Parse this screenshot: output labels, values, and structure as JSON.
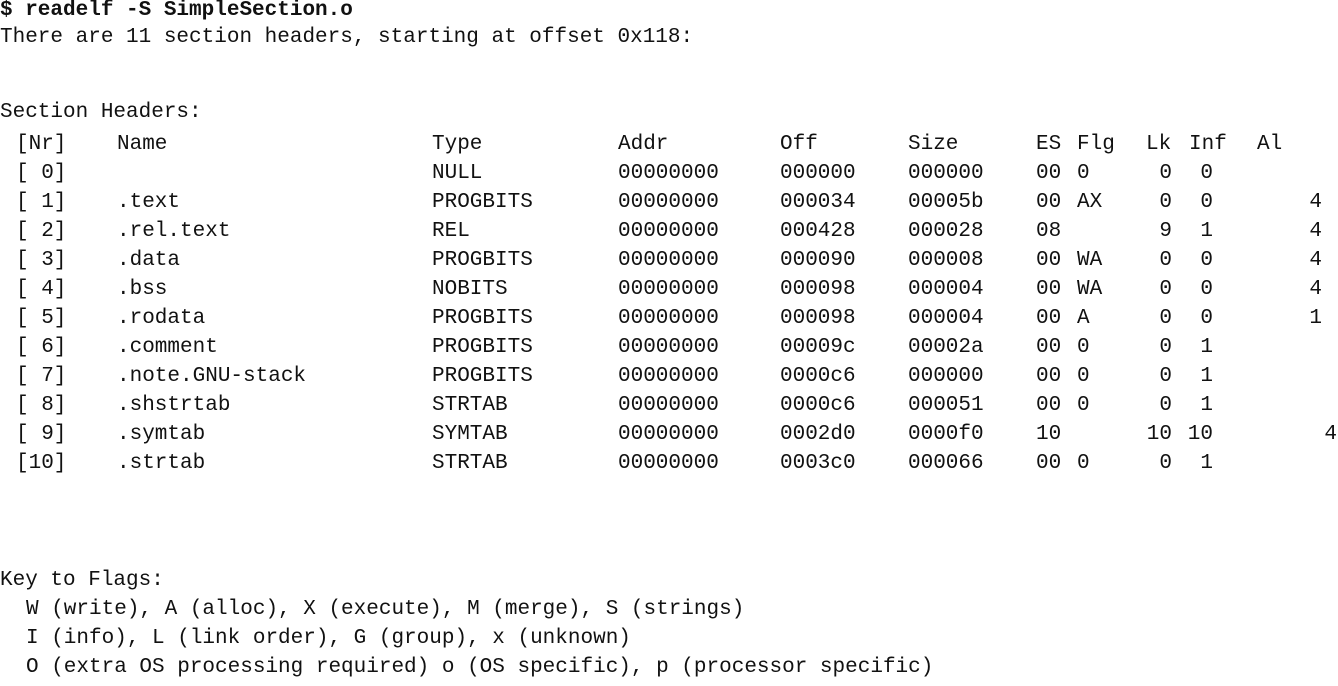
{
  "command": "$ readelf -S SimpleSection.o",
  "summary": "There are 11 section headers, starting at offset 0x118:",
  "section_headers_title": "Section Headers:",
  "columns": {
    "nr": "[Nr]",
    "name": "Name",
    "type": "Type",
    "addr": "Addr",
    "off": "Off",
    "size": "Size",
    "es": "ES",
    "flg": "Flg",
    "lk": "Lk",
    "inf": "Inf",
    "al": "Al"
  },
  "rows": [
    {
      "nr": "[ 0]",
      "name": "",
      "type": "NULL",
      "addr": "00000000",
      "off": "000000",
      "size": "000000",
      "es": "00",
      "flg": "0",
      "lk": "0",
      "inf": "0",
      "al": ""
    },
    {
      "nr": "[ 1]",
      "name": ".text",
      "type": "PROGBITS",
      "addr": "00000000",
      "off": "000034",
      "size": "00005b",
      "es": "00",
      "flg": "AX",
      "lk": "0",
      "inf": "0",
      "al": "4"
    },
    {
      "nr": "[ 2]",
      "name": ".rel.text",
      "type": "REL",
      "addr": "00000000",
      "off": "000428",
      "size": "000028",
      "es": "08",
      "flg": "",
      "lk": "9",
      "inf": "1",
      "al": "4"
    },
    {
      "nr": "[ 3]",
      "name": ".data",
      "type": "PROGBITS",
      "addr": "00000000",
      "off": "000090",
      "size": "000008",
      "es": "00",
      "flg": "WA",
      "lk": "0",
      "inf": "0",
      "al": "4"
    },
    {
      "nr": "[ 4]",
      "name": ".bss",
      "type": "NOBITS",
      "addr": "00000000",
      "off": "000098",
      "size": "000004",
      "es": "00",
      "flg": "WA",
      "lk": "0",
      "inf": "0",
      "al": "4"
    },
    {
      "nr": "[ 5]",
      "name": ".rodata",
      "type": "PROGBITS",
      "addr": "00000000",
      "off": "000098",
      "size": "000004",
      "es": "00",
      "flg": "A",
      "lk": "0",
      "inf": "0",
      "al": "1"
    },
    {
      "nr": "[ 6]",
      "name": ".comment",
      "type": "PROGBITS",
      "addr": "00000000",
      "off": "00009c",
      "size": "00002a",
      "es": "00",
      "flg": "0",
      "lk": "0",
      "inf": "1",
      "al": ""
    },
    {
      "nr": "[ 7]",
      "name": ".note.GNU-stack",
      "type": "PROGBITS",
      "addr": "00000000",
      "off": "0000c6",
      "size": "000000",
      "es": "00",
      "flg": "0",
      "lk": "0",
      "inf": "1",
      "al": ""
    },
    {
      "nr": "[ 8]",
      "name": ".shstrtab",
      "type": "STRTAB",
      "addr": "00000000",
      "off": "0000c6",
      "size": "000051",
      "es": "00",
      "flg": "0",
      "lk": "0",
      "inf": "1",
      "al": ""
    },
    {
      "nr": "[ 9]",
      "name": ".symtab",
      "type": "SYMTAB",
      "addr": "00000000",
      "off": "0002d0",
      "size": "0000f0",
      "es": "10",
      "flg": "",
      "lk": "10",
      "inf": "10",
      "al": "4"
    },
    {
      "nr": "[10]",
      "name": ".strtab",
      "type": "STRTAB",
      "addr": "00000000",
      "off": "0003c0",
      "size": "000066",
      "es": "00",
      "flg": "0",
      "lk": "0",
      "inf": "1",
      "al": ""
    }
  ],
  "key_title": "Key to Flags:",
  "key_lines": [
    "W (write), A (alloc), X (execute), M (merge), S (strings)",
    "I (info), L (link order), G (group), x (unknown)",
    "O (extra OS processing required) o (OS specific), p (processor specific)"
  ]
}
